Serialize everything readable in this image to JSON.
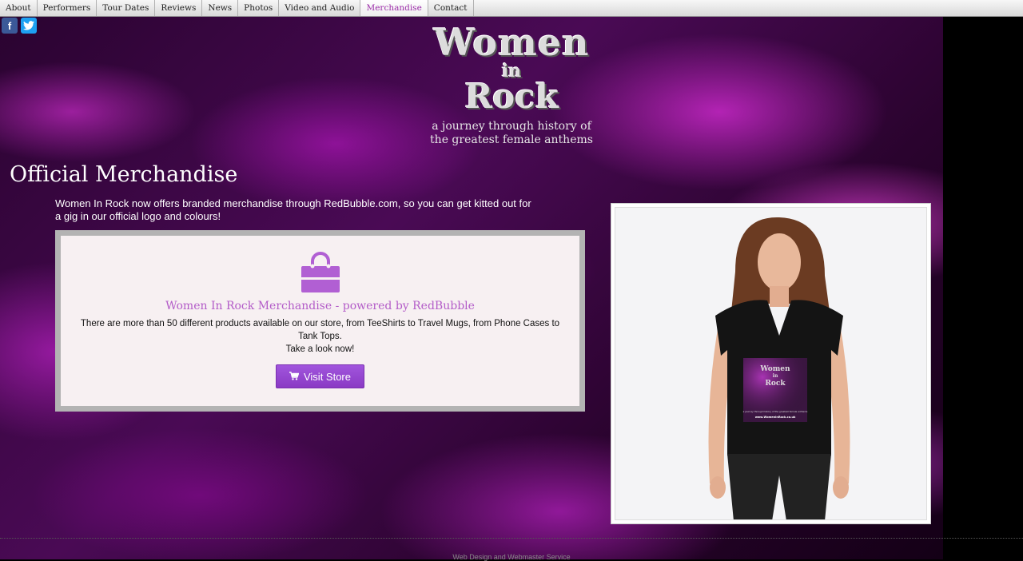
{
  "nav": {
    "items": [
      {
        "label": "About"
      },
      {
        "label": "Performers"
      },
      {
        "label": "Tour Dates"
      },
      {
        "label": "Reviews"
      },
      {
        "label": "News"
      },
      {
        "label": "Photos"
      },
      {
        "label": "Video and Audio"
      },
      {
        "label": "Merchandise",
        "active": true
      },
      {
        "label": "Contact"
      }
    ]
  },
  "social": {
    "facebook": "f",
    "twitter": "t"
  },
  "logo": {
    "line1": "Women",
    "line2": "in",
    "line3": "Rock",
    "tagline_1": "a journey through history of",
    "tagline_2": "the greatest female anthems"
  },
  "page": {
    "title": "Official Merchandise",
    "intro": "Women In Rock now offers branded merchandise through RedBubble.com, so you can get kitted out for a gig in our official logo and colours!"
  },
  "store": {
    "title": "Women In Rock Merchandise - powered by RedBubble",
    "desc_1": "There are more than 50 different products available on our store, from TeeShirts to Travel Mugs, from Phone Cases to Tank Tops.",
    "desc_2": "Take a look now!",
    "button_label": "Visit Store",
    "accent": "#9b4fd6"
  },
  "shirt_print": {
    "line1": "Women",
    "line2": "in",
    "line3": "Rock",
    "tagline": "a journey through history of the greatest female anthems",
    "url": "www.WomeninRock.co.uk"
  },
  "footer": {
    "text": "Web Design and Webmaster Service"
  }
}
